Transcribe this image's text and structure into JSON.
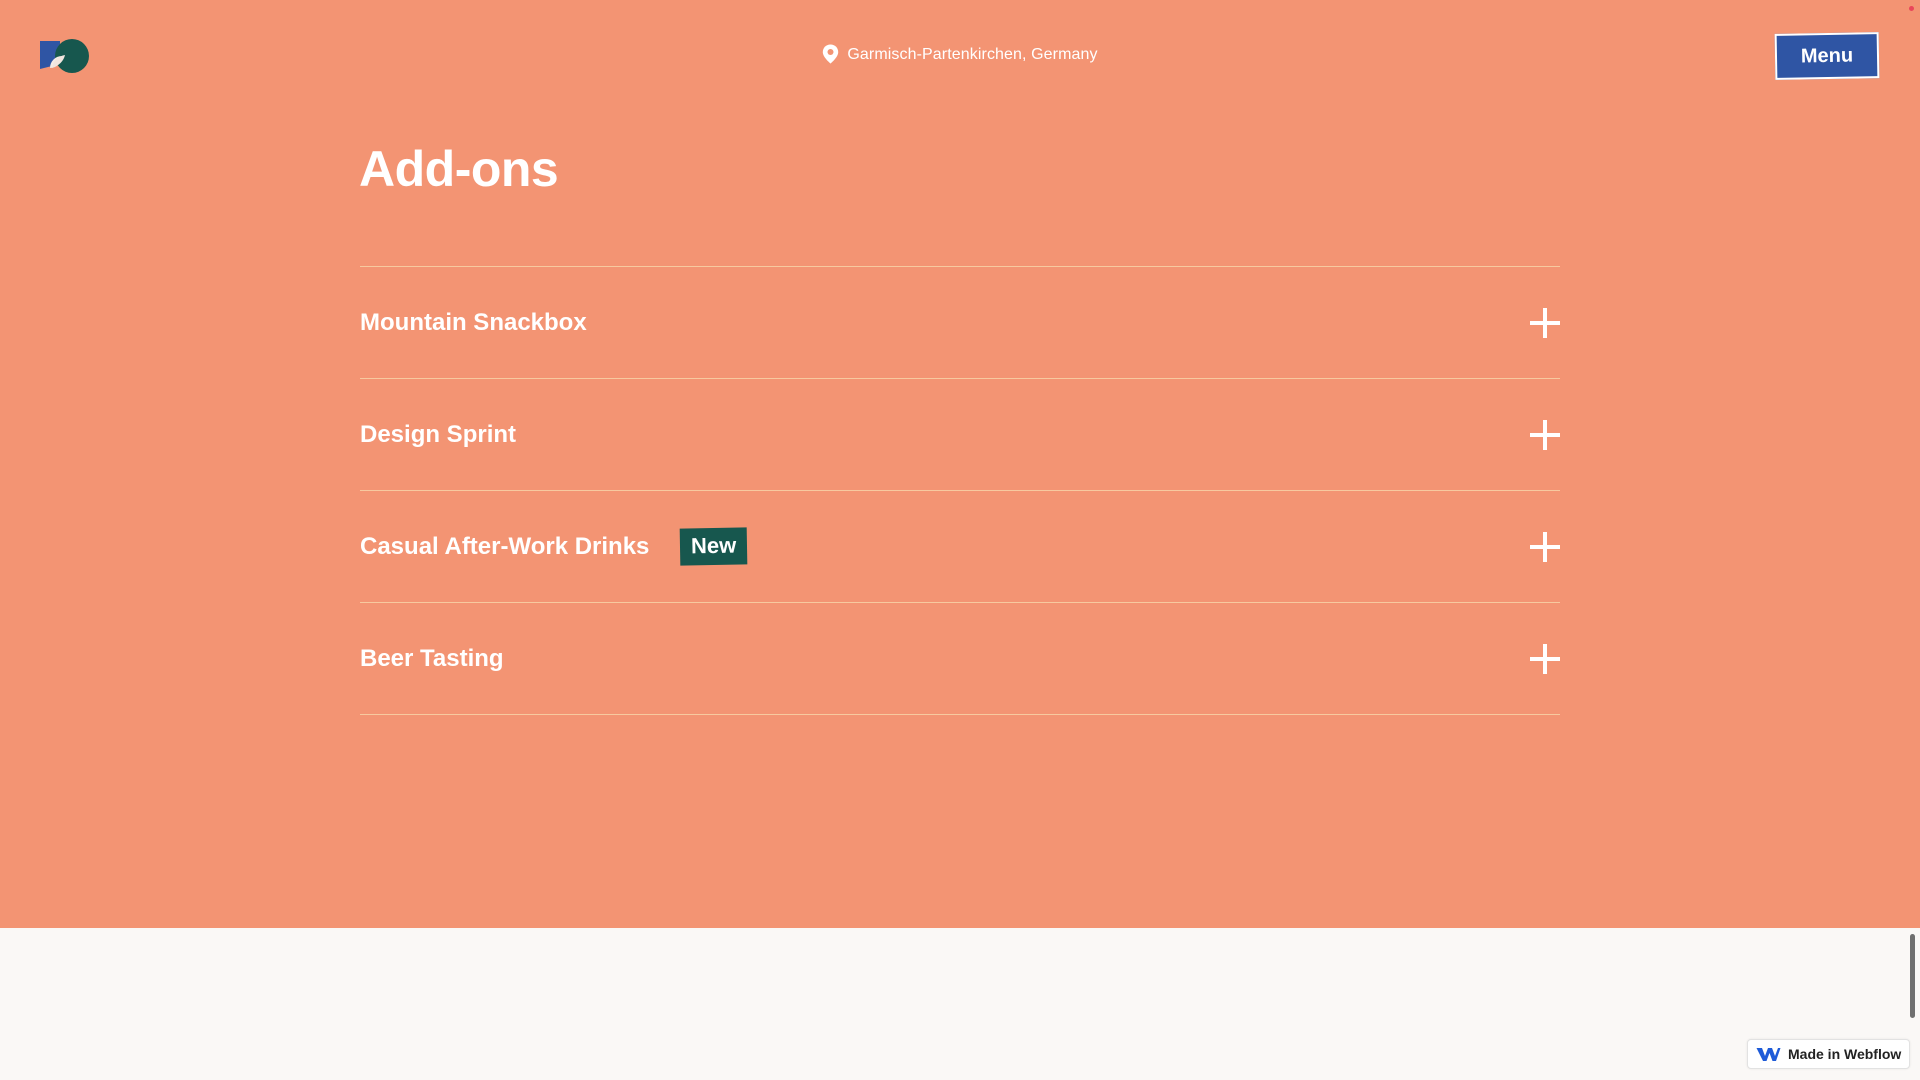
{
  "header": {
    "location": "Garmisch-Partenkirchen, Germany",
    "menu_label": "Menu"
  },
  "main": {
    "title": "Add-ons",
    "items": [
      {
        "label": "Mountain Snackbox",
        "badge": ""
      },
      {
        "label": "Design Sprint",
        "badge": ""
      },
      {
        "label": "Casual After-Work Drinks",
        "badge": "New"
      },
      {
        "label": "Beer Tasting",
        "badge": ""
      }
    ]
  },
  "footer": {
    "webflow_badge": "Made in Webflow"
  },
  "colors": {
    "background": "#f39473",
    "menu_button": "#2f55a4",
    "new_badge": "#17574e",
    "divider": "#f7c99f",
    "page_bottom": "#faf8f6"
  },
  "icons": [
    "logo-icon",
    "location-pin-icon",
    "plus-icon",
    "webflow-icon"
  ]
}
